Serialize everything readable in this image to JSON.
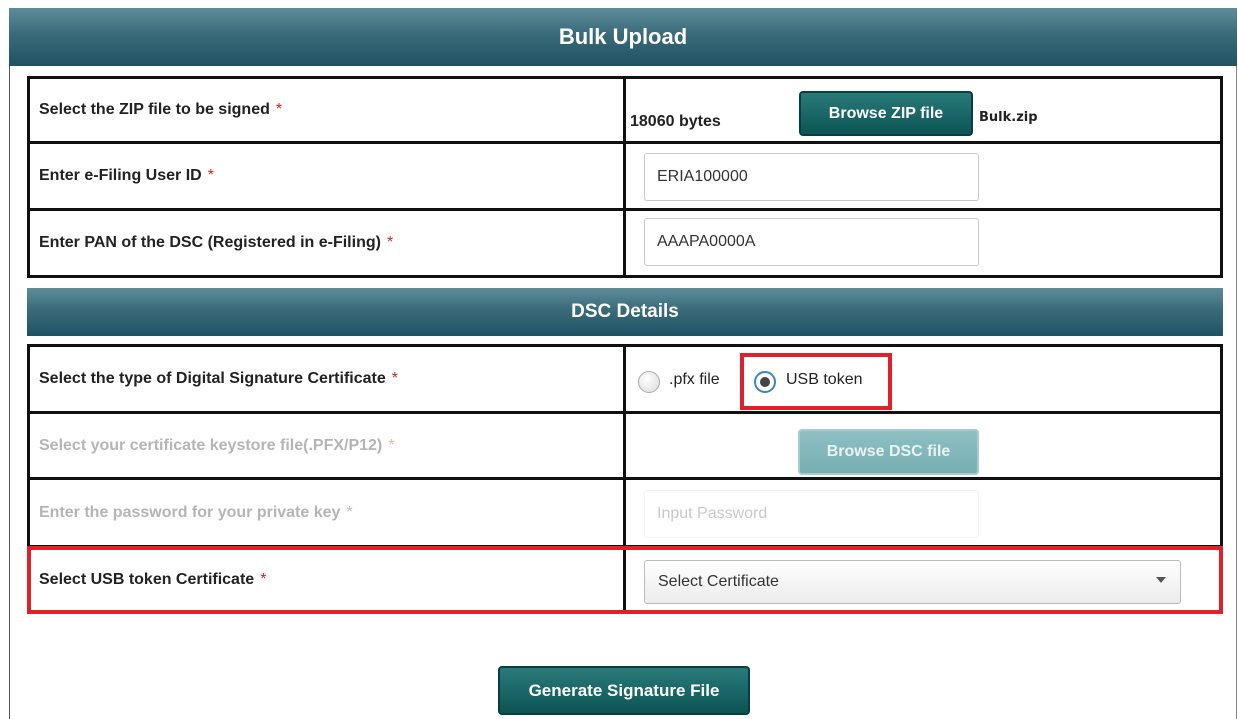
{
  "header": {
    "title": "Bulk Upload"
  },
  "zip_row": {
    "label": "Select the ZIP file to be signed",
    "required": "*",
    "size_text": "18060 bytes",
    "browse_label": "Browse ZIP file",
    "file_name": "Bulk.zip"
  },
  "user_row": {
    "label": "Enter e-Filing User ID",
    "required": "*",
    "value": "ERIA100000"
  },
  "pan_row": {
    "label": "Enter PAN of the DSC (Registered in e-Filing)",
    "required": "*",
    "value": "AAAPA0000A"
  },
  "dsc_header": {
    "title": "DSC Details"
  },
  "dsc_type_row": {
    "label": "Select the type of Digital Signature Certificate",
    "required": "*",
    "options": [
      {
        "label": ".pfx file",
        "selected": false
      },
      {
        "label": "USB token",
        "selected": true
      }
    ]
  },
  "keystore_row": {
    "label": "Select your certificate keystore file(.PFX/P12)",
    "required": "*",
    "browse_label": "Browse DSC file",
    "disabled": true
  },
  "password_row": {
    "label": "Enter the password for your private key",
    "required": "*",
    "placeholder": "Input Password",
    "disabled": true
  },
  "usb_cert_row": {
    "label": "Select USB token Certificate",
    "required": "*",
    "selected_value": "Select Certificate"
  },
  "actions": {
    "generate_label": "Generate Signature File"
  },
  "colors": {
    "accent": "#0d5454",
    "highlight": "#e0202a",
    "required": "#d9211b"
  }
}
